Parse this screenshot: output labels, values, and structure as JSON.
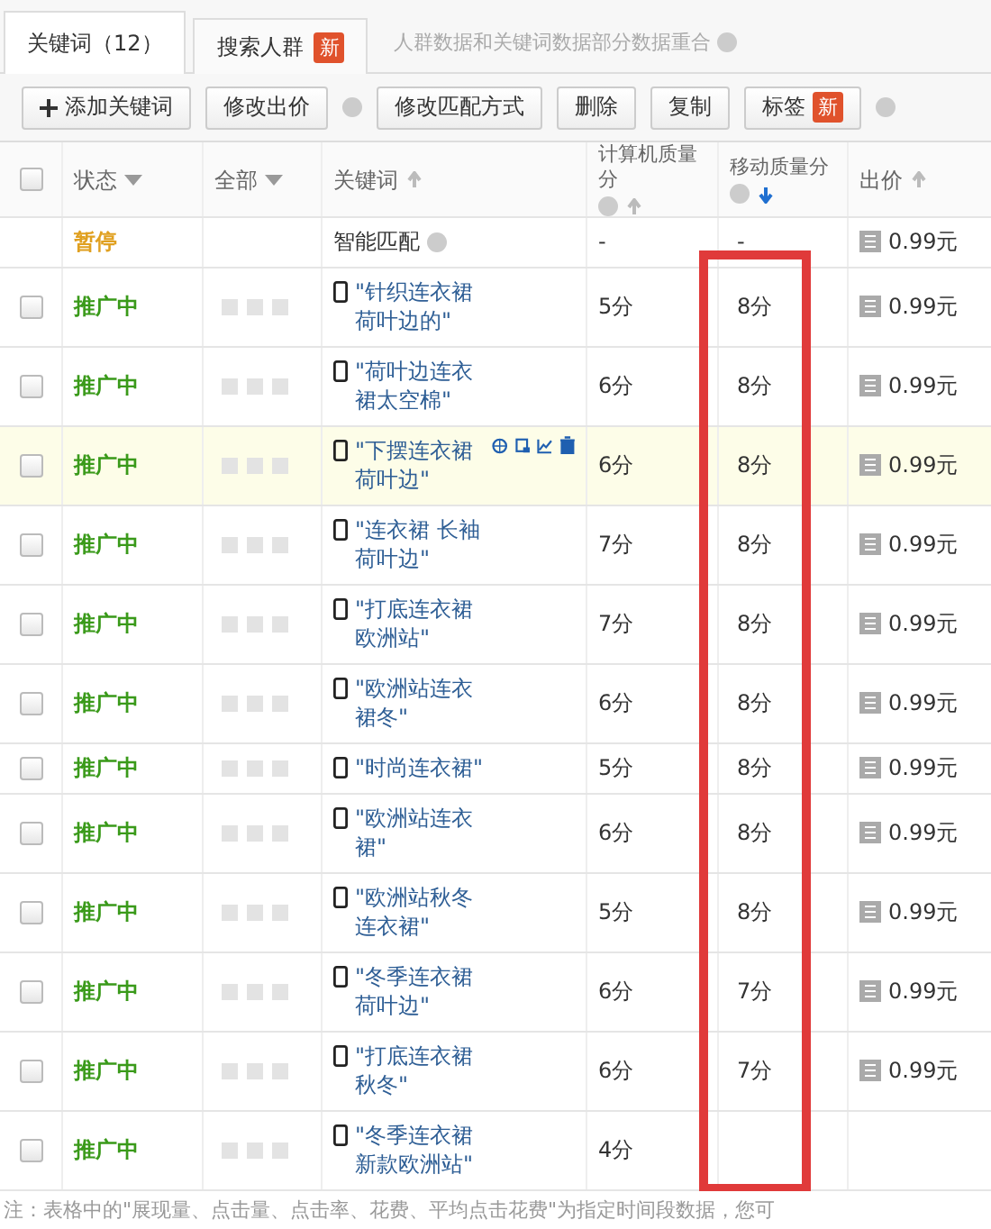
{
  "tabs": [
    {
      "label": "关键词（12）",
      "selected": true
    },
    {
      "label": "搜索人群",
      "selected": false,
      "badge": "新"
    }
  ],
  "tab_note": {
    "text": "人群数据和关键词数据部分数据重合",
    "help": true
  },
  "toolbar": [
    {
      "kind": "add",
      "label": "添加关键词",
      "help": false
    },
    {
      "kind": "plain",
      "label": "修改出价",
      "help": true
    },
    {
      "kind": "plain",
      "label": "修改匹配方式",
      "help": false
    },
    {
      "kind": "plain",
      "label": "删除",
      "help": false
    },
    {
      "kind": "plain",
      "label": "复制",
      "help": false
    },
    {
      "kind": "plain",
      "label": "标签",
      "badge": "新",
      "help": true
    }
  ],
  "table": {
    "select_all_checked": false,
    "columns": [
      {
        "kind": "filter",
        "label": "状态"
      },
      {
        "kind": "filter",
        "label": "全部"
      },
      {
        "kind": "sort",
        "label": "关键词",
        "sorted": false,
        "help": false
      },
      {
        "kind": "sort",
        "label": "计算机质量分",
        "sorted": false,
        "help": true
      },
      {
        "kind": "sort",
        "label": "移动质量分",
        "sorted": true,
        "help": true
      },
      {
        "kind": "sort",
        "label": "出价",
        "sorted": false,
        "help": false
      }
    ],
    "rows": [
      {
        "kind": "smart",
        "status": "暂停",
        "keyword": "智能匹配",
        "pc_score": "-",
        "mobile_score": "-",
        "price": "0.99元",
        "hovered": false
      },
      {
        "kind": "keyword",
        "status": "推广中",
        "keyword": "\"针织连衣裙荷叶边的\"",
        "pc_score": "5分",
        "mobile_score": "8分",
        "price": "0.99元",
        "checked": false,
        "hovered": false
      },
      {
        "kind": "keyword",
        "status": "推广中",
        "keyword": "\"荷叶边连衣裙太空棉\"",
        "pc_score": "6分",
        "mobile_score": "8分",
        "price": "0.99元",
        "checked": false,
        "hovered": false
      },
      {
        "kind": "keyword",
        "status": "推广中",
        "keyword": "\"下摆连衣裙荷叶边\"",
        "pc_score": "6分",
        "mobile_score": "8分",
        "price": "0.99元",
        "checked": false,
        "hovered": true
      },
      {
        "kind": "keyword",
        "status": "推广中",
        "keyword": "\"连衣裙 长袖荷叶边\"",
        "pc_score": "7分",
        "mobile_score": "8分",
        "price": "0.99元",
        "checked": false,
        "hovered": false
      },
      {
        "kind": "keyword",
        "status": "推广中",
        "keyword": "\"打底连衣裙欧洲站\"",
        "pc_score": "7分",
        "mobile_score": "8分",
        "price": "0.99元",
        "checked": false,
        "hovered": false
      },
      {
        "kind": "keyword",
        "status": "推广中",
        "keyword": "\"欧洲站连衣裙冬\"",
        "pc_score": "6分",
        "mobile_score": "8分",
        "price": "0.99元",
        "checked": false,
        "hovered": false
      },
      {
        "kind": "keyword",
        "status": "推广中",
        "keyword": "\"时尚连衣裙\"",
        "pc_score": "5分",
        "mobile_score": "8分",
        "price": "0.99元",
        "checked": false,
        "hovered": false
      },
      {
        "kind": "keyword",
        "status": "推广中",
        "keyword": "\"欧洲站连衣裙\"",
        "pc_score": "6分",
        "mobile_score": "8分",
        "price": "0.99元",
        "checked": false,
        "hovered": false
      },
      {
        "kind": "keyword",
        "status": "推广中",
        "keyword": "\"欧洲站秋冬连衣裙\"",
        "pc_score": "5分",
        "mobile_score": "8分",
        "price": "0.99元",
        "checked": false,
        "hovered": false
      },
      {
        "kind": "keyword",
        "status": "推广中",
        "keyword": "\"冬季连衣裙荷叶边\"",
        "pc_score": "6分",
        "mobile_score": "7分",
        "price": "0.99元",
        "checked": false,
        "hovered": false
      },
      {
        "kind": "keyword",
        "status": "推广中",
        "keyword": "\"打底连衣裙秋冬\"",
        "pc_score": "6分",
        "mobile_score": "7分",
        "price": "0.99元",
        "checked": false,
        "hovered": false
      },
      {
        "kind": "keyword",
        "status": "推广中",
        "keyword": "\"冬季连衣裙新款欧洲站\"",
        "pc_score": "4分",
        "checked": false,
        "hovered": false
      }
    ]
  },
  "footnote": "注：表格中的\"展现量、点击量、点击率、花费、平均点击花费\"为指定时间段数据，您可"
}
